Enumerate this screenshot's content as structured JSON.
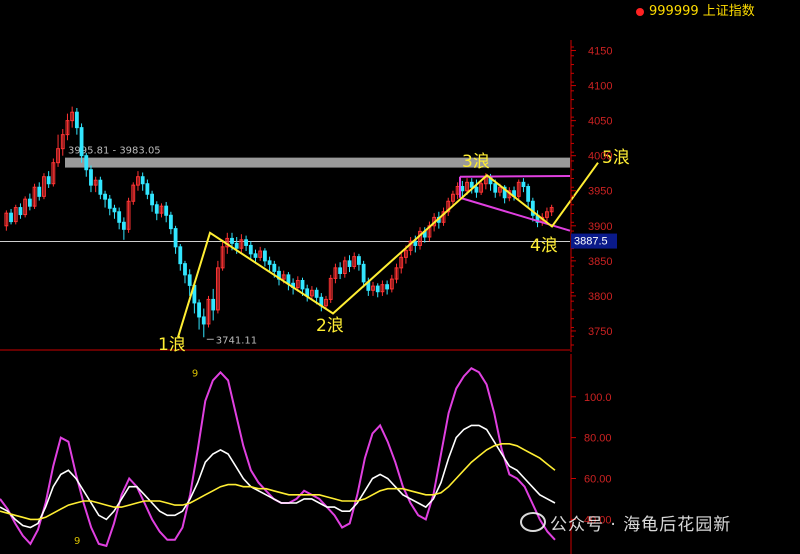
{
  "header": {
    "code": "999999",
    "name": "上证指数"
  },
  "watermark": {
    "text": "公众号 · 海龟后花园新"
  },
  "colors": {
    "up": "#ff3333",
    "down": "#33e6ff",
    "wave": "#ffee33",
    "channel": "#e040e0",
    "band": "#9a9a9a",
    "axis": "#cc0000",
    "price_tag_bg": "#0a1a8a",
    "white_line": "#ffffff"
  },
  "chart_data": [
    {
      "type": "candlestick",
      "ylim": [
        3720,
        4165
      ],
      "y_ticks": [
        "4150",
        "4100",
        "4050",
        "4000",
        "3950",
        "3900",
        "3850",
        "3800",
        "3750"
      ],
      "band_label": "3995.81 - 3983.05",
      "band_range": [
        3983.05,
        3995.81
      ],
      "low_label": "3741.11",
      "current_price": "3887.5",
      "waves": [
        {
          "label": "1浪",
          "price": 3741
        },
        {
          "label": "",
          "price": 3890
        },
        {
          "label": "2浪",
          "price": 3775
        },
        {
          "label": "3浪",
          "price": 3972
        },
        {
          "label": "4浪",
          "price": 3899
        },
        {
          "label": "5浪",
          "price": 3990
        }
      ],
      "candles": [
        [
          3900,
          3918,
          3893,
          3922
        ],
        [
          3918,
          3906,
          3902,
          3924
        ],
        [
          3906,
          3926,
          3902,
          3930
        ],
        [
          3926,
          3916,
          3910,
          3932
        ],
        [
          3916,
          3938,
          3912,
          3942
        ],
        [
          3938,
          3928,
          3922,
          3946
        ],
        [
          3928,
          3955,
          3924,
          3960
        ],
        [
          3955,
          3942,
          3936,
          3962
        ],
        [
          3942,
          3970,
          3938,
          3975
        ],
        [
          3970,
          3960,
          3954,
          3978
        ],
        [
          3960,
          3990,
          3956,
          3996
        ],
        [
          3990,
          4010,
          3984,
          4030
        ],
        [
          4010,
          4030,
          4000,
          4038
        ],
        [
          4030,
          4050,
          4022,
          4060
        ],
        [
          4050,
          4062,
          4040,
          4070
        ],
        [
          4062,
          4040,
          4030,
          4068
        ],
        [
          4040,
          4000,
          3990,
          4046
        ],
        [
          4000,
          3980,
          3970,
          4004
        ],
        [
          3980,
          3958,
          3948,
          3986
        ],
        [
          3958,
          3965,
          3948,
          3970
        ],
        [
          3965,
          3945,
          3938,
          3970
        ],
        [
          3945,
          3938,
          3926,
          3950
        ],
        [
          3938,
          3925,
          3915,
          3944
        ],
        [
          3925,
          3920,
          3910,
          3930
        ],
        [
          3920,
          3905,
          3895,
          3926
        ],
        [
          3905,
          3895,
          3880,
          3912
        ],
        [
          3895,
          3935,
          3890,
          3940
        ],
        [
          3935,
          3958,
          3930,
          3962
        ],
        [
          3958,
          3970,
          3950,
          3978
        ],
        [
          3970,
          3960,
          3950,
          3976
        ],
        [
          3960,
          3945,
          3938,
          3966
        ],
        [
          3945,
          3930,
          3920,
          3950
        ],
        [
          3930,
          3918,
          3908,
          3935
        ],
        [
          3918,
          3928,
          3912,
          3932
        ],
        [
          3928,
          3915,
          3905,
          3934
        ],
        [
          3915,
          3896,
          3888,
          3920
        ],
        [
          3896,
          3870,
          3860,
          3900
        ],
        [
          3870,
          3846,
          3836,
          3874
        ],
        [
          3846,
          3830,
          3818,
          3850
        ],
        [
          3830,
          3815,
          3800,
          3838
        ],
        [
          3815,
          3790,
          3775,
          3820
        ],
        [
          3790,
          3770,
          3752,
          3795
        ],
        [
          3770,
          3760,
          3741,
          3782
        ],
        [
          3760,
          3795,
          3755,
          3800
        ],
        [
          3795,
          3780,
          3765,
          3810
        ],
        [
          3780,
          3840,
          3775,
          3850
        ],
        [
          3840,
          3870,
          3836,
          3880
        ],
        [
          3870,
          3882,
          3860,
          3890
        ],
        [
          3882,
          3875,
          3865,
          3890
        ],
        [
          3875,
          3868,
          3860,
          3884
        ],
        [
          3868,
          3880,
          3862,
          3888
        ],
        [
          3880,
          3872,
          3864,
          3886
        ],
        [
          3872,
          3860,
          3852,
          3878
        ],
        [
          3860,
          3855,
          3846,
          3866
        ],
        [
          3855,
          3864,
          3850,
          3870
        ],
        [
          3864,
          3850,
          3842,
          3868
        ],
        [
          3850,
          3845,
          3834,
          3856
        ],
        [
          3845,
          3835,
          3826,
          3850
        ],
        [
          3835,
          3824,
          3815,
          3842
        ],
        [
          3824,
          3830,
          3818,
          3836
        ],
        [
          3830,
          3818,
          3808,
          3834
        ],
        [
          3818,
          3812,
          3802,
          3825
        ],
        [
          3812,
          3822,
          3806,
          3828
        ],
        [
          3822,
          3810,
          3800,
          3826
        ],
        [
          3810,
          3800,
          3792,
          3816
        ],
        [
          3800,
          3808,
          3794,
          3814
        ],
        [
          3808,
          3798,
          3788,
          3812
        ],
        [
          3798,
          3786,
          3778,
          3804
        ],
        [
          3786,
          3795,
          3780,
          3800
        ],
        [
          3795,
          3825,
          3790,
          3830
        ],
        [
          3825,
          3840,
          3818,
          3846
        ],
        [
          3840,
          3832,
          3824,
          3848
        ],
        [
          3832,
          3850,
          3826,
          3856
        ],
        [
          3850,
          3842,
          3834,
          3858
        ],
        [
          3842,
          3856,
          3838,
          3862
        ],
        [
          3856,
          3845,
          3836,
          3860
        ],
        [
          3845,
          3820,
          3812,
          3850
        ],
        [
          3820,
          3808,
          3800,
          3826
        ],
        [
          3808,
          3814,
          3800,
          3820
        ],
        [
          3814,
          3806,
          3798,
          3818
        ],
        [
          3806,
          3816,
          3800,
          3822
        ],
        [
          3816,
          3810,
          3802,
          3822
        ],
        [
          3810,
          3824,
          3805,
          3830
        ],
        [
          3824,
          3840,
          3818,
          3846
        ],
        [
          3840,
          3855,
          3832,
          3862
        ],
        [
          3855,
          3865,
          3846,
          3872
        ],
        [
          3865,
          3878,
          3858,
          3884
        ],
        [
          3878,
          3872,
          3862,
          3886
        ],
        [
          3872,
          3892,
          3866,
          3898
        ],
        [
          3892,
          3884,
          3876,
          3898
        ],
        [
          3884,
          3900,
          3878,
          3906
        ],
        [
          3900,
          3912,
          3892,
          3918
        ],
        [
          3912,
          3905,
          3896,
          3920
        ],
        [
          3905,
          3920,
          3900,
          3926
        ],
        [
          3920,
          3935,
          3914,
          3940
        ],
        [
          3935,
          3945,
          3928,
          3950
        ],
        [
          3945,
          3956,
          3938,
          3962
        ],
        [
          3956,
          3950,
          3940,
          3964
        ],
        [
          3950,
          3962,
          3944,
          3968
        ],
        [
          3962,
          3955,
          3946,
          3968
        ],
        [
          3955,
          3948,
          3940,
          3966
        ],
        [
          3948,
          3960,
          3944,
          3965
        ],
        [
          3960,
          3970,
          3952,
          3975
        ],
        [
          3970,
          3960,
          3950,
          3974
        ],
        [
          3960,
          3948,
          3940,
          3966
        ],
        [
          3948,
          3955,
          3942,
          3960
        ],
        [
          3955,
          3940,
          3932,
          3958
        ],
        [
          3940,
          3950,
          3935,
          3955
        ],
        [
          3950,
          3942,
          3936,
          3956
        ],
        [
          3942,
          3962,
          3938,
          3966
        ],
        [
          3962,
          3956,
          3948,
          3968
        ],
        [
          3956,
          3935,
          3926,
          3960
        ],
        [
          3935,
          3915,
          3906,
          3940
        ],
        [
          3915,
          3905,
          3898,
          3922
        ],
        [
          3905,
          3912,
          3900,
          3918
        ],
        [
          3912,
          3920,
          3906,
          3926
        ],
        [
          3920,
          3926,
          3914,
          3930
        ]
      ]
    },
    {
      "type": "line",
      "ylim": [
        25,
        118
      ],
      "y_ticks": [
        "100.0",
        "80.00",
        "60.00",
        "40.00"
      ],
      "marks": [
        {
          "label": "9",
          "x": 6,
          "y": 14
        },
        {
          "label": "9",
          "x": 76,
          "y": 28
        },
        {
          "label": "9",
          "x": 197,
          "y": 110
        }
      ],
      "series": [
        {
          "color": "#e040e0",
          "values": [
            50,
            45,
            38,
            32,
            28,
            35,
            48,
            66,
            80,
            78,
            62,
            48,
            36,
            28,
            27,
            38,
            52,
            60,
            56,
            48,
            40,
            34,
            30,
            30,
            36,
            52,
            74,
            98,
            108,
            112,
            108,
            92,
            76,
            64,
            58,
            54,
            50,
            48,
            48,
            50,
            54,
            52,
            50,
            46,
            42,
            36,
            38,
            52,
            70,
            82,
            86,
            78,
            68,
            56,
            48,
            42,
            40,
            52,
            72,
            92,
            104,
            110,
            114,
            112,
            106,
            92,
            74,
            62,
            60,
            56,
            48,
            40,
            34,
            30
          ]
        },
        {
          "color": "#ffffff",
          "values": [
            46,
            44,
            40,
            37,
            36,
            38,
            46,
            56,
            62,
            64,
            60,
            54,
            48,
            42,
            40,
            44,
            50,
            56,
            56,
            52,
            48,
            44,
            42,
            42,
            44,
            50,
            58,
            68,
            72,
            74,
            72,
            66,
            60,
            56,
            54,
            52,
            50,
            48,
            48,
            48,
            50,
            50,
            48,
            46,
            46,
            44,
            44,
            48,
            54,
            60,
            62,
            60,
            56,
            52,
            50,
            48,
            46,
            50,
            58,
            70,
            80,
            84,
            86,
            86,
            84,
            78,
            72,
            66,
            64,
            60,
            56,
            52,
            50,
            48
          ]
        },
        {
          "color": "#ffee33",
          "values": [
            44,
            43,
            42,
            41,
            40,
            40,
            41,
            43,
            45,
            47,
            48,
            49,
            49,
            48,
            47,
            46,
            46,
            47,
            48,
            49,
            49,
            49,
            48,
            47,
            47,
            48,
            50,
            52,
            54,
            56,
            57,
            57,
            56,
            56,
            55,
            55,
            54,
            53,
            52,
            52,
            52,
            52,
            52,
            51,
            50,
            49,
            49,
            49,
            50,
            52,
            54,
            55,
            55,
            55,
            54,
            53,
            52,
            52,
            53,
            56,
            60,
            64,
            68,
            71,
            74,
            76,
            77,
            77,
            76,
            74,
            72,
            70,
            67,
            64
          ]
        }
      ]
    }
  ]
}
